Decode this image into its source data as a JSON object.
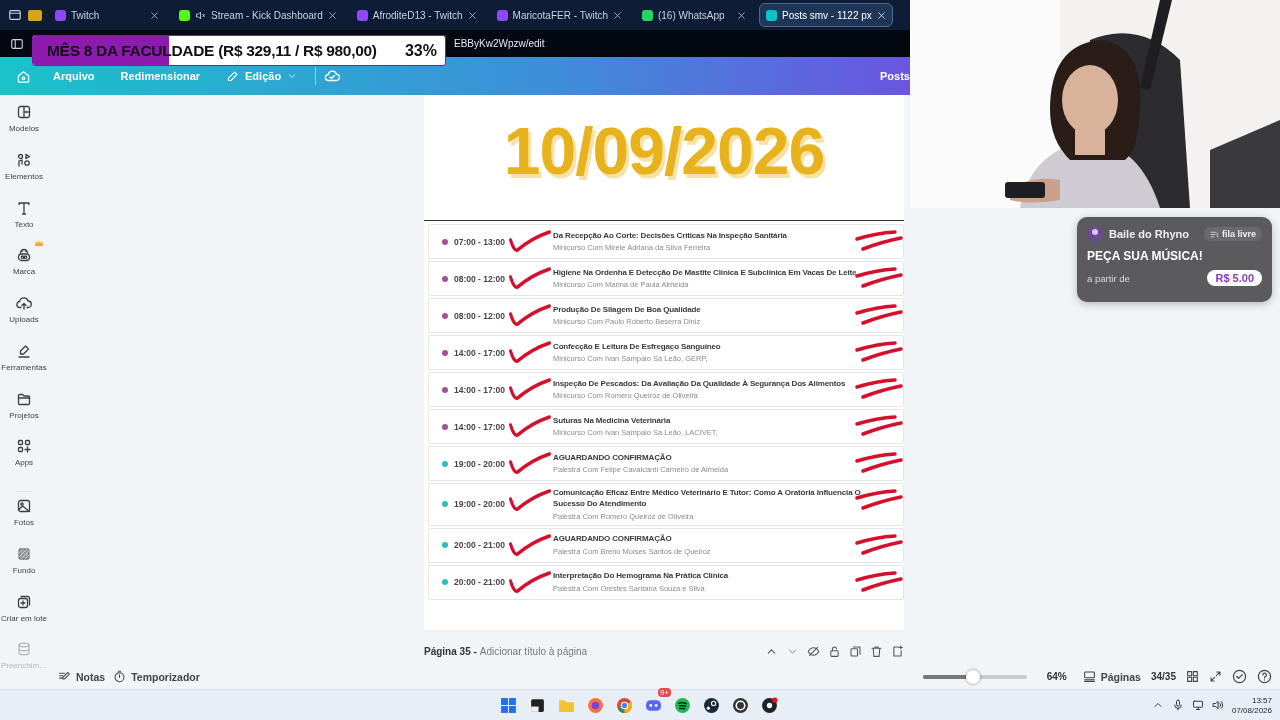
{
  "browser": {
    "tabs": [
      {
        "label": "Twitch",
        "selected": false,
        "muted": false
      },
      {
        "label": "Stream - Kick Dashboard",
        "selected": false,
        "muted": true
      },
      {
        "label": "AfroditeD13 - Twitch",
        "selected": false,
        "muted": false
      },
      {
        "label": "MaricotaFER - Twitch",
        "selected": false,
        "muted": false
      },
      {
        "label": "(16) WhatsApp",
        "selected": false,
        "muted": false
      },
      {
        "label": "Posts smv - 1122 px",
        "selected": true,
        "muted": false
      }
    ],
    "url": "EBByKw2Wpzw/edit"
  },
  "goal_overlay": {
    "label": "MÊS 8 DA FACULDADE (R$ 329,11 / R$ 980,00)",
    "percent": "33%",
    "level": 0.33
  },
  "toolbar": {
    "menu": [
      "Arquivo",
      "Redimensionar",
      "Edição"
    ],
    "right_button": "Posts"
  },
  "sidebar": {
    "items": [
      {
        "label": "Modelos",
        "disabled": false
      },
      {
        "label": "Elementos",
        "disabled": false
      },
      {
        "label": "Texto",
        "disabled": false
      },
      {
        "label": "Marca",
        "disabled": false
      },
      {
        "label": "Uploads",
        "disabled": false
      },
      {
        "label": "Ferramentas",
        "disabled": false
      },
      {
        "label": "Projetos",
        "disabled": false
      },
      {
        "label": "Apps",
        "disabled": false
      }
    ],
    "extra_items": [
      {
        "label": "Fotos",
        "disabled": false
      },
      {
        "label": "Fundo",
        "disabled": false
      },
      {
        "label": "Criar em lote",
        "disabled": false
      },
      {
        "label": "Preenchim…",
        "disabled": true
      }
    ]
  },
  "page": {
    "date": "10/09/2026",
    "rows": [
      {
        "time": "07:00 - 13:00",
        "color": "#a34f9c",
        "title": "Da Recepção Ao Corte: Decisões Críticas Na Inspeção Sanitária",
        "subtitle": "Minicurso Com Mirele Adriana da Silva Ferreira",
        "checked": true
      },
      {
        "time": "08:00 - 12:00",
        "color": "#a34f9c",
        "title": "Higiene Na Ordenha E Detecção De Mastite Clínica E Subclínica Em Vacas De Leite",
        "subtitle": "Minicurso Com Marina de Paula Almeida",
        "checked": true
      },
      {
        "time": "08:00 - 12:00",
        "color": "#a34f9c",
        "title": "Produção De Silagem De Boa Qualidade",
        "subtitle": "Minicurso Com Paulo Roberto Beserra Diniz",
        "checked": true
      },
      {
        "time": "14:00 - 17:00",
        "color": "#a34f9c",
        "title": "Confecção E Leitura De Esfregaço Sanguíneo",
        "subtitle": "Minicurso Com Ivan Sampaio Sá Leão, GERP,",
        "checked": true
      },
      {
        "time": "14:00 - 17:00",
        "color": "#a34f9c",
        "title": "Inspeção De Pescados: Da Avaliação Da Qualidade À Segurança Dos Alimentos",
        "subtitle": "Minicurso Com Romero Queiroz de Oliveira",
        "checked": true
      },
      {
        "time": "14:00 - 17:00",
        "color": "#a34f9c",
        "title": "Suturas Na Medicina Veterinária",
        "subtitle": "Minicurso Com Ivan Sampaio Sá Leão, LACIVET,",
        "checked": true
      },
      {
        "time": "19:00 - 20:00",
        "color": "#2bbcc6",
        "title": "AGUARDANDO CONFIRMAÇÃO",
        "subtitle": "Palestra Com Felipe Cavalcanti Carneiro de Almeida",
        "checked": true
      },
      {
        "time": "19:00 - 20:00",
        "color": "#2bbcc6",
        "title": "Comunicação Eficaz Entre Médico Veterinário E Tutor: Como A Oratória Influencia O Sucesso Do Atendimento",
        "subtitle": "Palestra Com Romero Queiroz de Oliveira",
        "checked": true
      },
      {
        "time": "20:00 - 21:00",
        "color": "#2bbcc6",
        "title": "AGUARDANDO CONFIRMAÇÃO",
        "subtitle": "Palestra Com Breno Moises Santos de Queiroz",
        "checked": true
      },
      {
        "time": "20:00 - 21:00",
        "color": "#2bbcc6",
        "title": "Interpretação Do Hemograma Na Prática Clínica",
        "subtitle": "Palestra Com Orestes Santana Souza e Silva",
        "checked": true
      }
    ]
  },
  "page_bar": {
    "page": "Página 35 -",
    "title_placeholder": "Adicionar título à página"
  },
  "footer": {
    "notes": "Notas",
    "timer": "Temporizador",
    "zoom": {
      "level": 0.48,
      "reading": "64%"
    },
    "pages": "Páginas",
    "page_count": "34/35"
  },
  "song_card": {
    "channel": "Baile do Rhyno",
    "queue": "fila livre",
    "headline": "PEÇA SUA MÚSICA!",
    "price_label": "a partir de",
    "price": "R$ 5.00"
  },
  "taskbar": {
    "badge": "9+",
    "time": "13:57",
    "date": "07/08/2026"
  }
}
